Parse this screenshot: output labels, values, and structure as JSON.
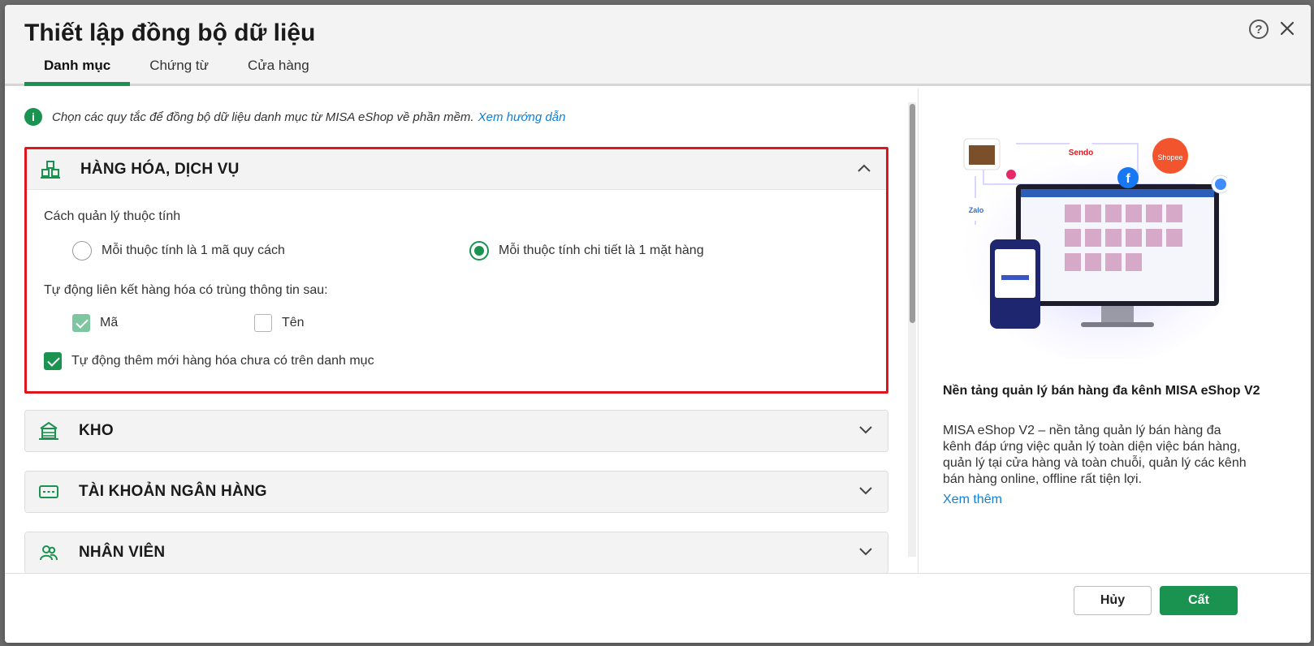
{
  "dialog": {
    "title": "Thiết lập đồng bộ dữ liệu",
    "help_icon": "question-circle-icon",
    "close_icon": "close-icon"
  },
  "tabs": [
    {
      "label": "Danh mục",
      "active": true
    },
    {
      "label": "Chứng từ",
      "active": false
    },
    {
      "label": "Cửa hàng",
      "active": false
    }
  ],
  "info": {
    "text": "Chọn các quy tắc để đồng bộ dữ liệu danh mục từ MISA eShop về phần mềm.",
    "link": "Xem hướng dẫn"
  },
  "sections": {
    "goods": {
      "title": "HÀNG HÓA, DỊCH VỤ",
      "icon": "boxes-icon",
      "expanded": true,
      "attr_mgmt_label": "Cách quản lý thuộc tính",
      "radio_options": [
        {
          "label": "Mỗi thuộc tính là 1 mã quy cách",
          "selected": false
        },
        {
          "label": "Mỗi thuộc tính chi tiết là 1 mặt hàng",
          "selected": true
        }
      ],
      "auto_link_label": "Tự động liên kết hàng hóa có trùng thông tin sau:",
      "link_options": [
        {
          "label": "Mã",
          "checked": true
        },
        {
          "label": "Tên",
          "checked": false
        }
      ],
      "auto_add": {
        "label": "Tự động thêm mới hàng hóa chưa có trên danh mục",
        "checked": true
      }
    },
    "warehouse": {
      "title": "KHO",
      "icon": "warehouse-icon",
      "expanded": false
    },
    "bank": {
      "title": "TÀI KHOẢN NGÂN HÀNG",
      "icon": "bank-card-icon",
      "expanded": false
    },
    "staff": {
      "title": "NHÂN VIÊN",
      "icon": "users-icon",
      "expanded": false
    }
  },
  "promo": {
    "title": "Nền tảng quản lý bán hàng đa kênh MISA eShop V2",
    "description": "MISA eShop V2 – nền tảng quản lý bán hàng đa kênh đáp ứng việc quản lý toàn diện việc bán hàng, quản lý tại cửa hàng và toàn chuỗi, quản lý các kênh bán hàng online, offline rất tiện lợi.",
    "link": "Xem thêm",
    "art_labels": {
      "sendo": "Sendo",
      "zalo": "Zalo",
      "shopee": "Shopee",
      "facebook": "f"
    }
  },
  "footer": {
    "cancel_label": "Hủy",
    "save_label": "Cất"
  },
  "colors": {
    "accent": "#1a9350",
    "highlight_border": "#e0161e",
    "link": "#0f7fd8"
  }
}
